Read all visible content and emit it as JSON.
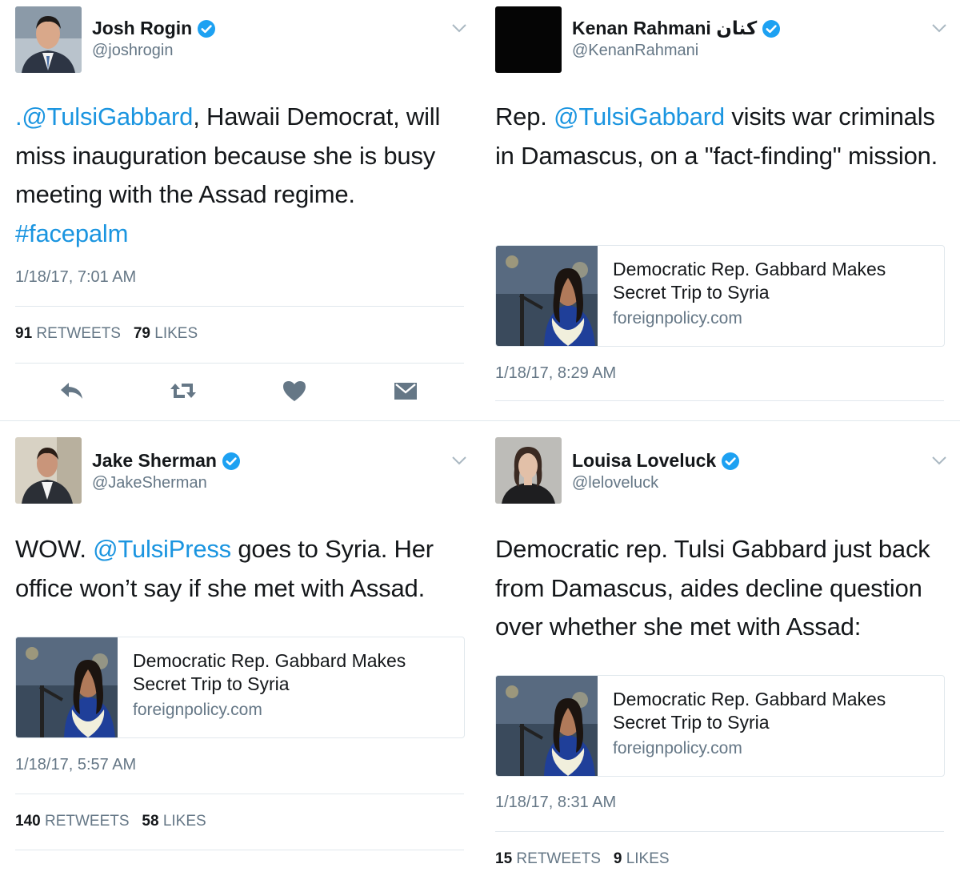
{
  "tweets": [
    {
      "name": "Josh Rogin",
      "handle": "@joshrogin",
      "text": [
        {
          "t": ".@TulsiGabbard",
          "link": true
        },
        {
          "t": ", Hawaii Democrat, will miss inauguration because she is busy meeting with the Assad regime. ",
          "link": false
        },
        {
          "t": "#facepalm",
          "link": true
        }
      ],
      "timestamp": "1/18/17, 7:01 AM",
      "retweets": "91",
      "retweets_label": "RETWEETS",
      "likes": "79",
      "likes_label": "LIKES",
      "card": null
    },
    {
      "name": "Kenan Rahmani كنان",
      "handle": "@KenanRahmani",
      "text": [
        {
          "t": "Rep. ",
          "link": false
        },
        {
          "t": "@TulsiGabbard",
          "link": true
        },
        {
          "t": " visits war criminals in Damascus, on a \"fact-finding\" mission.",
          "link": false
        }
      ],
      "timestamp": "1/18/17, 8:29 AM",
      "card": {
        "title": "Democratic Rep. Gabbard Makes Secret Trip to Syria",
        "domain": "foreignpolicy.com"
      }
    },
    {
      "name": "Jake Sherman",
      "handle": "@JakeSherman",
      "text": [
        {
          "t": "WOW. ",
          "link": false
        },
        {
          "t": "@TulsiPress",
          "link": true
        },
        {
          "t": " goes to Syria. Her office won’t say if she met with Assad.",
          "link": false
        }
      ],
      "timestamp": "1/18/17, 5:57 AM",
      "retweets": "140",
      "retweets_label": "RETWEETS",
      "likes": "58",
      "likes_label": "LIKES",
      "card": {
        "title": "Democratic Rep. Gabbard Makes Secret Trip to Syria",
        "domain": "foreignpolicy.com"
      }
    },
    {
      "name": "Louisa Loveluck",
      "handle": "@leloveluck",
      "text": [
        {
          "t": "Democratic rep. Tulsi Gabbard just back from Damascus, aides decline question over whether she met with Assad:",
          "link": false
        }
      ],
      "timestamp": "1/18/17, 8:31 AM",
      "retweets": "15",
      "retweets_label": "RETWEETS",
      "likes": "9",
      "likes_label": "LIKES",
      "card": {
        "title": "Democratic Rep. Gabbard Makes Secret Trip to Syria",
        "domain": "foreignpolicy.com"
      }
    }
  ],
  "colors": {
    "link": "#1b95e0",
    "verified": "#1da1f2",
    "secondary_text": "#657786",
    "primary_text": "#14171a",
    "divider": "#e1e8ed"
  },
  "icons": [
    "verified-badge-icon",
    "chevron-down-icon",
    "reply-icon",
    "retweet-icon",
    "like-icon",
    "direct-message-icon"
  ]
}
